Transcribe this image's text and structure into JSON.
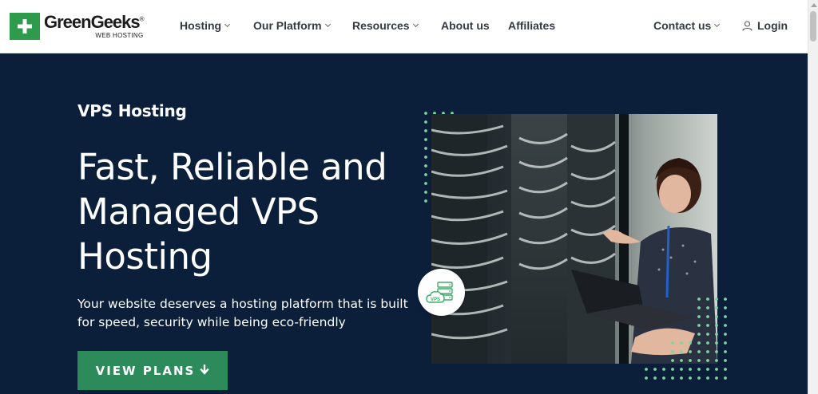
{
  "header": {
    "logo": {
      "name": "GreenGeeks",
      "registered": "®",
      "sub": "WEB HOSTING"
    },
    "nav": [
      {
        "label": "Hosting",
        "has_dropdown": true
      },
      {
        "label": "Our Platform",
        "has_dropdown": true
      },
      {
        "label": "Resources",
        "has_dropdown": true
      },
      {
        "label": "About us",
        "has_dropdown": false
      },
      {
        "label": "Affiliates",
        "has_dropdown": false
      },
      {
        "label": "Contact us",
        "has_dropdown": true
      },
      {
        "label": "Login",
        "icon": "user-icon"
      }
    ]
  },
  "hero": {
    "eyebrow": "VPS Hosting",
    "headline": "Fast, Reliable and Managed VPS Hosting",
    "subtext": "Your website deserves a hosting platform that is built for speed, security while being eco-friendly",
    "cta_label": "VIEW PLANS",
    "cta_icon": "arrow-down-icon",
    "badge_label": "VPS",
    "badge_icon": "vps-cloud-server-icon"
  },
  "colors": {
    "brand_green": "#2d9a4c",
    "hero_bg": "#0b1f3a",
    "cta_bg": "#2d8a5a",
    "dot_green": "#7fd4a0",
    "nav_text": "#333a44"
  }
}
